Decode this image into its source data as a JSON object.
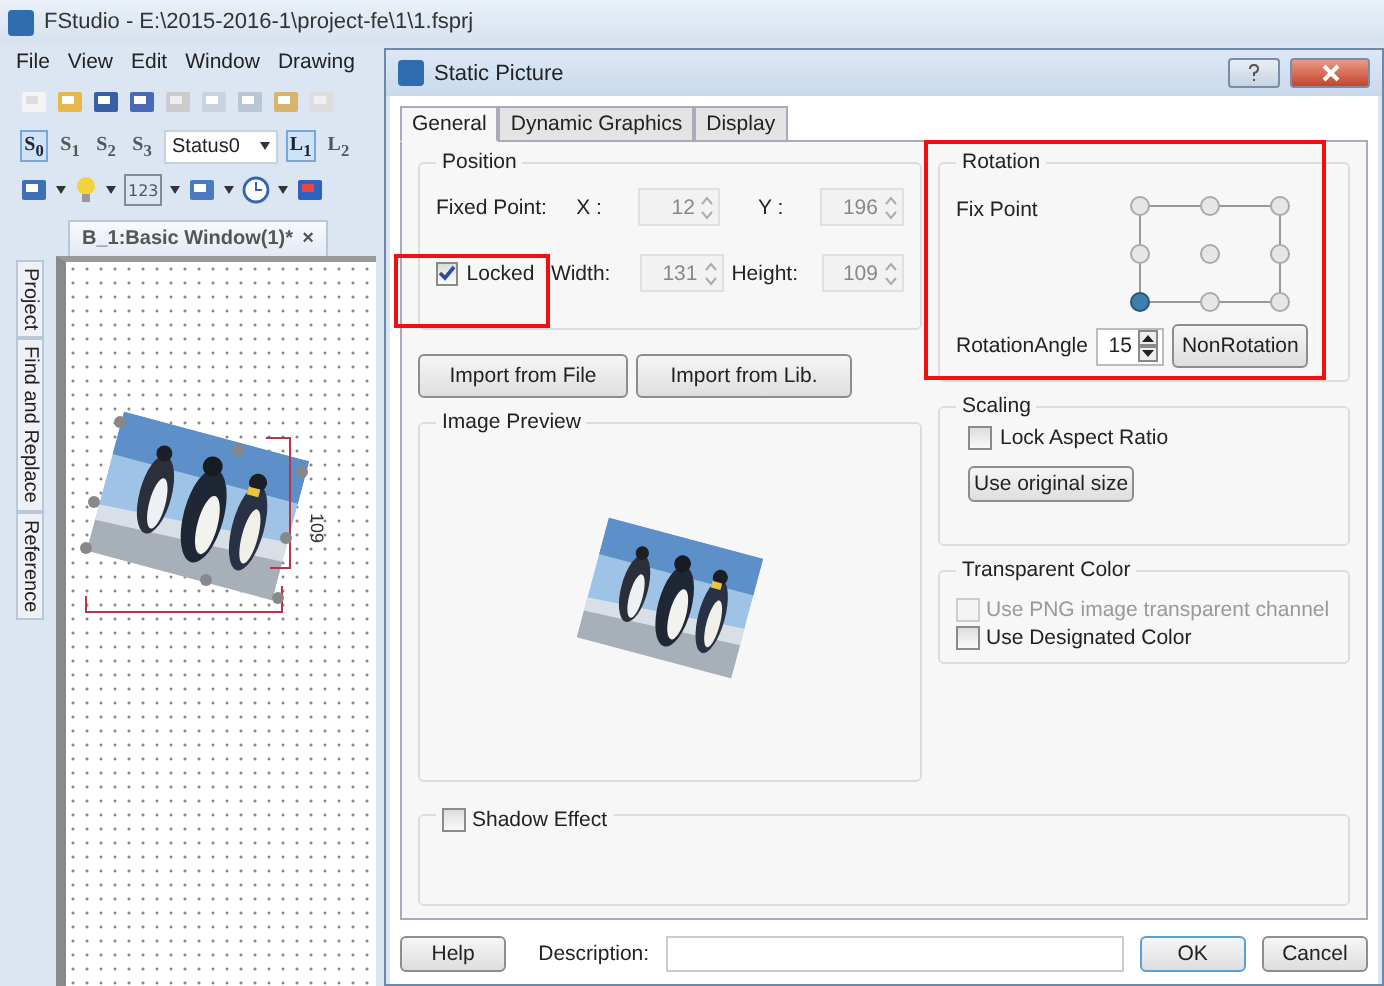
{
  "app": {
    "title": "FStudio - E:\\2015-2016-1\\project-fe\\1\\1.fsprj",
    "menu": [
      "File",
      "View",
      "Edit",
      "Window",
      "Drawing"
    ],
    "status_buttons": [
      {
        "label": "S$_{0}$",
        "selected": true
      },
      {
        "label": "S$_{1}$",
        "selected": false
      },
      {
        "label": "S$_{2}$",
        "selected": false
      },
      {
        "label": "S$_{3}$",
        "selected": false
      }
    ],
    "status_select": "Status0",
    "layer_buttons": [
      {
        "label": "L$_{1}$",
        "selected": true
      },
      {
        "label": "L$_{2}$",
        "selected": false
      }
    ],
    "numeric_tool_label": "123",
    "document_tab": {
      "title": "B_1:Basic Window(1)*",
      "close": "×"
    },
    "side_tabs": [
      "Project",
      "Find and Replace",
      "Reference"
    ],
    "canvas": {
      "dimension_label": "109"
    }
  },
  "dialog": {
    "title": "Static Picture",
    "tabs": [
      {
        "label": "General",
        "selected": true
      },
      {
        "label": "Dynamic Graphics",
        "selected": false
      },
      {
        "label": "Display",
        "selected": false
      }
    ],
    "position": {
      "title": "Position",
      "fixed_point_label": "Fixed Point:",
      "x_label": "X :",
      "x_value": "12",
      "y_label": "Y :",
      "y_value": "196",
      "locked": {
        "label": "Locked",
        "checked": true
      },
      "width_label": "Width:",
      "width_value": "131",
      "height_label": "Height:",
      "height_value": "109"
    },
    "import_buttons": [
      "Import from File",
      "Import from Lib."
    ],
    "image_preview": {
      "title": "Image Preview"
    },
    "rotation": {
      "title": "Rotation",
      "fix_point_label": "Fix Point",
      "fix_points": [
        {
          "selected": false
        },
        {
          "selected": false
        },
        {
          "selected": false
        },
        {
          "selected": false
        },
        {
          "selected": false
        },
        {
          "selected": false
        },
        {
          "selected": true
        },
        {
          "selected": false
        },
        {
          "selected": false
        }
      ],
      "angle_label": "RotationAngle",
      "angle_value": "15",
      "reset_button": "NonRotation"
    },
    "scaling": {
      "title": "Scaling",
      "lock_aspect": {
        "label": "Lock Aspect Ratio",
        "checked": false
      },
      "button": "Use original size"
    },
    "transparent": {
      "title": "Transparent Color",
      "options": [
        {
          "label": "Use PNG image transparent channel",
          "checked": false,
          "disabled": true
        },
        {
          "label": "Use Designated Color",
          "checked": false,
          "disabled": false
        }
      ]
    },
    "shadow": {
      "label": "Shadow Effect",
      "checked": false
    },
    "footer": {
      "help": "Help",
      "description_label": "Description:",
      "ok": "OK",
      "cancel": "Cancel"
    }
  }
}
